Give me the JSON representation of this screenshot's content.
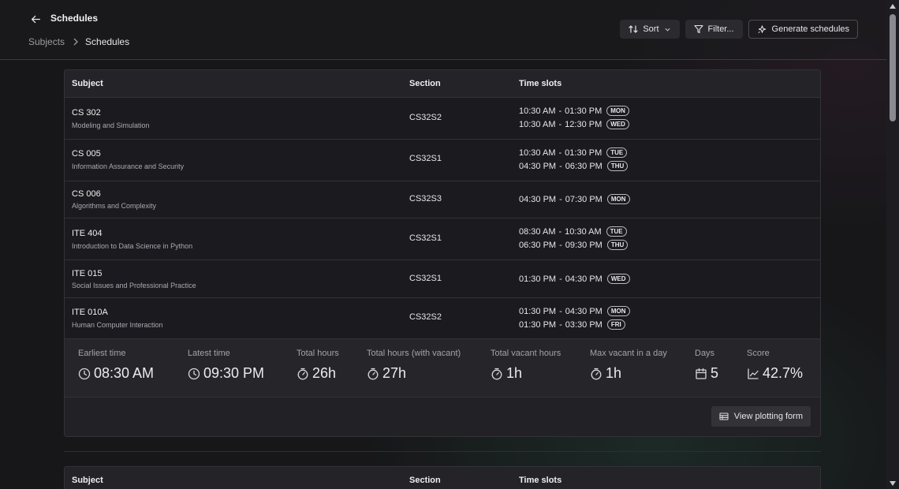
{
  "header": {
    "title": "Schedules",
    "breadcrumb": {
      "parent": "Subjects",
      "current": "Schedules"
    },
    "toolbar": {
      "sort_label": "Sort",
      "filter_label": "Filter...",
      "generate_label": "Generate schedules"
    }
  },
  "table": {
    "columns": {
      "subject": "Subject",
      "section": "Section",
      "time_slots": "Time slots"
    },
    "rows": [
      {
        "code": "CS 302",
        "name": "Modeling and Simulation",
        "section": "CS32S2",
        "slots": [
          {
            "start": "10:30 AM",
            "end": "01:30 PM",
            "day": "MON"
          },
          {
            "start": "10:30 AM",
            "end": "12:30 PM",
            "day": "WED"
          }
        ]
      },
      {
        "code": "CS 005",
        "name": "Information Assurance and Security",
        "section": "CS32S1",
        "slots": [
          {
            "start": "10:30 AM",
            "end": "01:30 PM",
            "day": "TUE"
          },
          {
            "start": "04:30 PM",
            "end": "06:30 PM",
            "day": "THU"
          }
        ]
      },
      {
        "code": "CS 006",
        "name": "Algorithms and Complexity",
        "section": "CS32S3",
        "slots": [
          {
            "start": "04:30 PM",
            "end": "07:30 PM",
            "day": "MON"
          }
        ]
      },
      {
        "code": "ITE 404",
        "name": "Introduction to Data Science in Python",
        "section": "CS32S1",
        "slots": [
          {
            "start": "08:30 AM",
            "end": "10:30 AM",
            "day": "TUE"
          },
          {
            "start": "06:30 PM",
            "end": "09:30 PM",
            "day": "THU"
          }
        ]
      },
      {
        "code": "ITE 015",
        "name": "Social Issues and Professional Practice",
        "section": "CS32S1",
        "slots": [
          {
            "start": "01:30 PM",
            "end": "04:30 PM",
            "day": "WED"
          }
        ]
      },
      {
        "code": "ITE 010A",
        "name": "Human Computer Interaction",
        "section": "CS32S2",
        "slots": [
          {
            "start": "01:30 PM",
            "end": "04:30 PM",
            "day": "MON"
          },
          {
            "start": "01:30 PM",
            "end": "03:30 PM",
            "day": "FRI"
          }
        ]
      }
    ]
  },
  "stats": {
    "earliest": {
      "label": "Earliest time",
      "value": "08:30 AM",
      "icon": "clock-icon"
    },
    "latest": {
      "label": "Latest time",
      "value": "09:30 PM",
      "icon": "clock-icon"
    },
    "total_hours": {
      "label": "Total hours",
      "value": "26h",
      "icon": "timer-icon"
    },
    "total_with_vacant": {
      "label": "Total hours (with vacant)",
      "value": "27h",
      "icon": "timer-icon"
    },
    "total_vacant": {
      "label": "Total vacant hours",
      "value": "1h",
      "icon": "timer-icon"
    },
    "max_vacant": {
      "label": "Max vacant in a day",
      "value": "1h",
      "icon": "timer-icon"
    },
    "days": {
      "label": "Days",
      "value": "5",
      "icon": "calendar-icon"
    },
    "score": {
      "label": "Score",
      "value": "42.7%",
      "icon": "trend-icon"
    }
  },
  "footer": {
    "plot_label": "View plotting form"
  },
  "table2": {
    "columns": {
      "subject": "Subject",
      "section": "Section",
      "time_slots": "Time slots"
    }
  }
}
